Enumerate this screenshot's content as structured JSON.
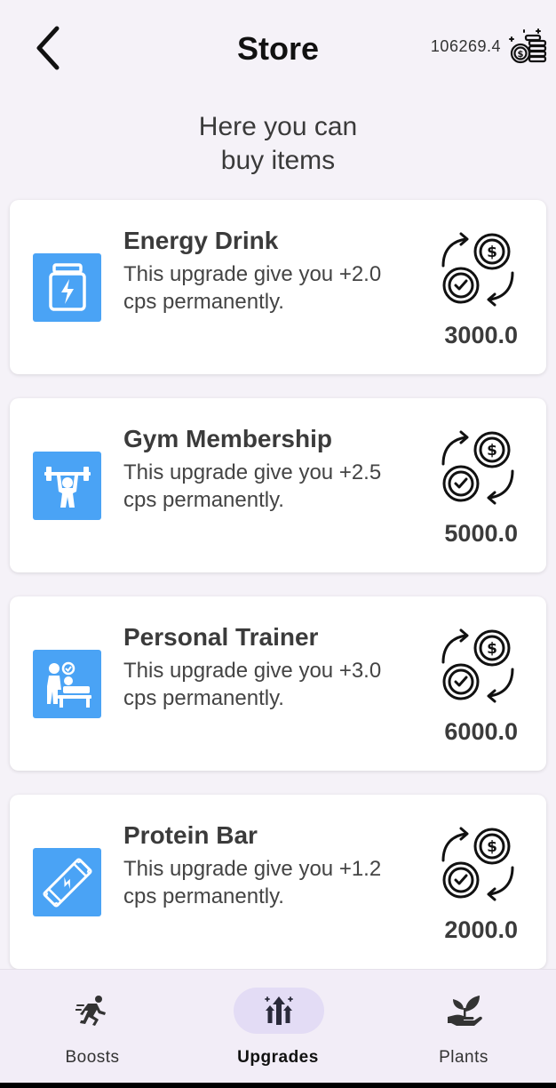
{
  "header": {
    "title": "Store",
    "balance": "106269.4",
    "back_icon": "chevron-left-icon",
    "currency_icon": "coins-stack-icon"
  },
  "subtitle": {
    "line1": "Here you can",
    "line2": "buy items"
  },
  "items": [
    {
      "name": "Energy Drink",
      "description": "This upgrade give you +2.0 cps permanently.",
      "price": "3000.0",
      "icon": "energy-drink-icon"
    },
    {
      "name": "Gym Membership",
      "description": "This upgrade give you +2.5 cps permanently.",
      "price": "5000.0",
      "icon": "weightlifter-icon"
    },
    {
      "name": "Personal Trainer",
      "description": "This upgrade give you +3.0 cps permanently.",
      "price": "6000.0",
      "icon": "trainer-icon"
    },
    {
      "name": "Protein Bar",
      "description": "This upgrade give you +1.2 cps permanently.",
      "price": "2000.0",
      "icon": "protein-bar-icon"
    }
  ],
  "nav": {
    "items": [
      {
        "label": "Boosts",
        "icon": "runner-icon",
        "active": false
      },
      {
        "label": "Upgrades",
        "icon": "upgrade-arrows-icon",
        "active": true
      },
      {
        "label": "Plants",
        "icon": "plant-hand-icon",
        "active": false
      }
    ]
  },
  "colors": {
    "accent": "#4aa3f5",
    "background": "#f5f2f8",
    "nav_active_pill": "#e3dcf5"
  }
}
